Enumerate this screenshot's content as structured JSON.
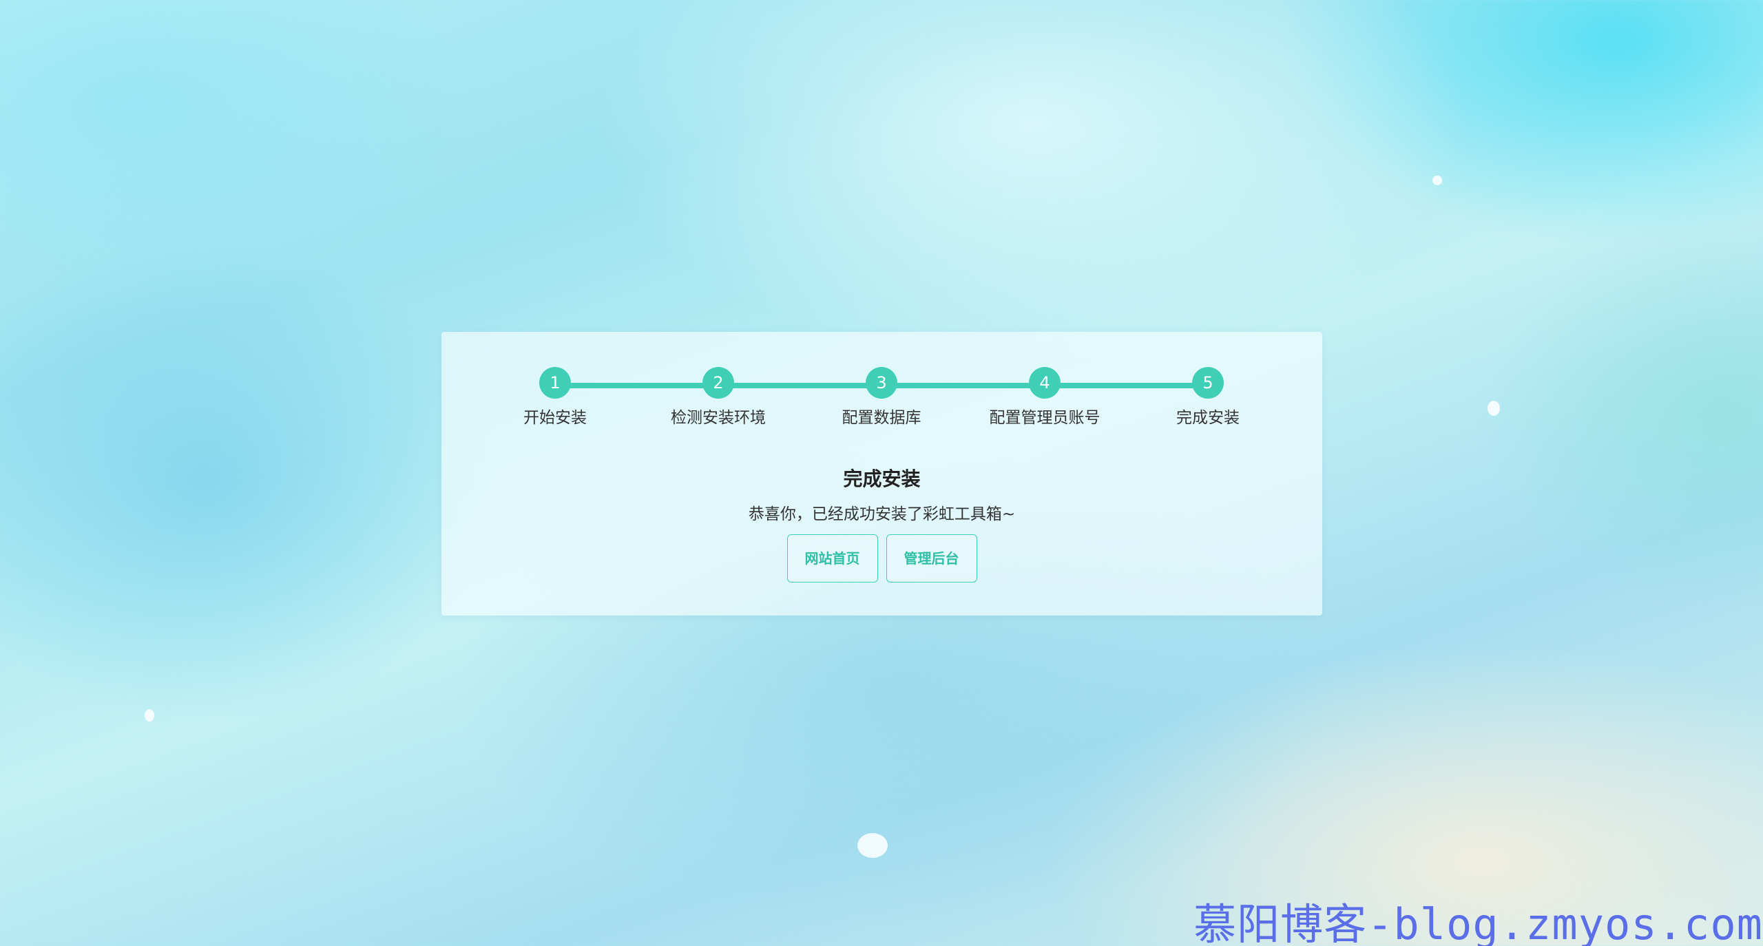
{
  "steps": [
    {
      "number": "1",
      "label": "开始安装"
    },
    {
      "number": "2",
      "label": "检测安装环境"
    },
    {
      "number": "3",
      "label": "配置数据库"
    },
    {
      "number": "4",
      "label": "配置管理员账号"
    },
    {
      "number": "5",
      "label": "完成安装"
    }
  ],
  "result": {
    "title": "完成安装",
    "message": "恭喜你，已经成功安装了彩虹工具箱~"
  },
  "buttons": {
    "home": "网站首页",
    "admin": "管理后台"
  },
  "watermark": "慕阳博客-blog.zmyos.com",
  "colors": {
    "accent": "#3ecfb6",
    "watermark": "#5a6ee8"
  }
}
